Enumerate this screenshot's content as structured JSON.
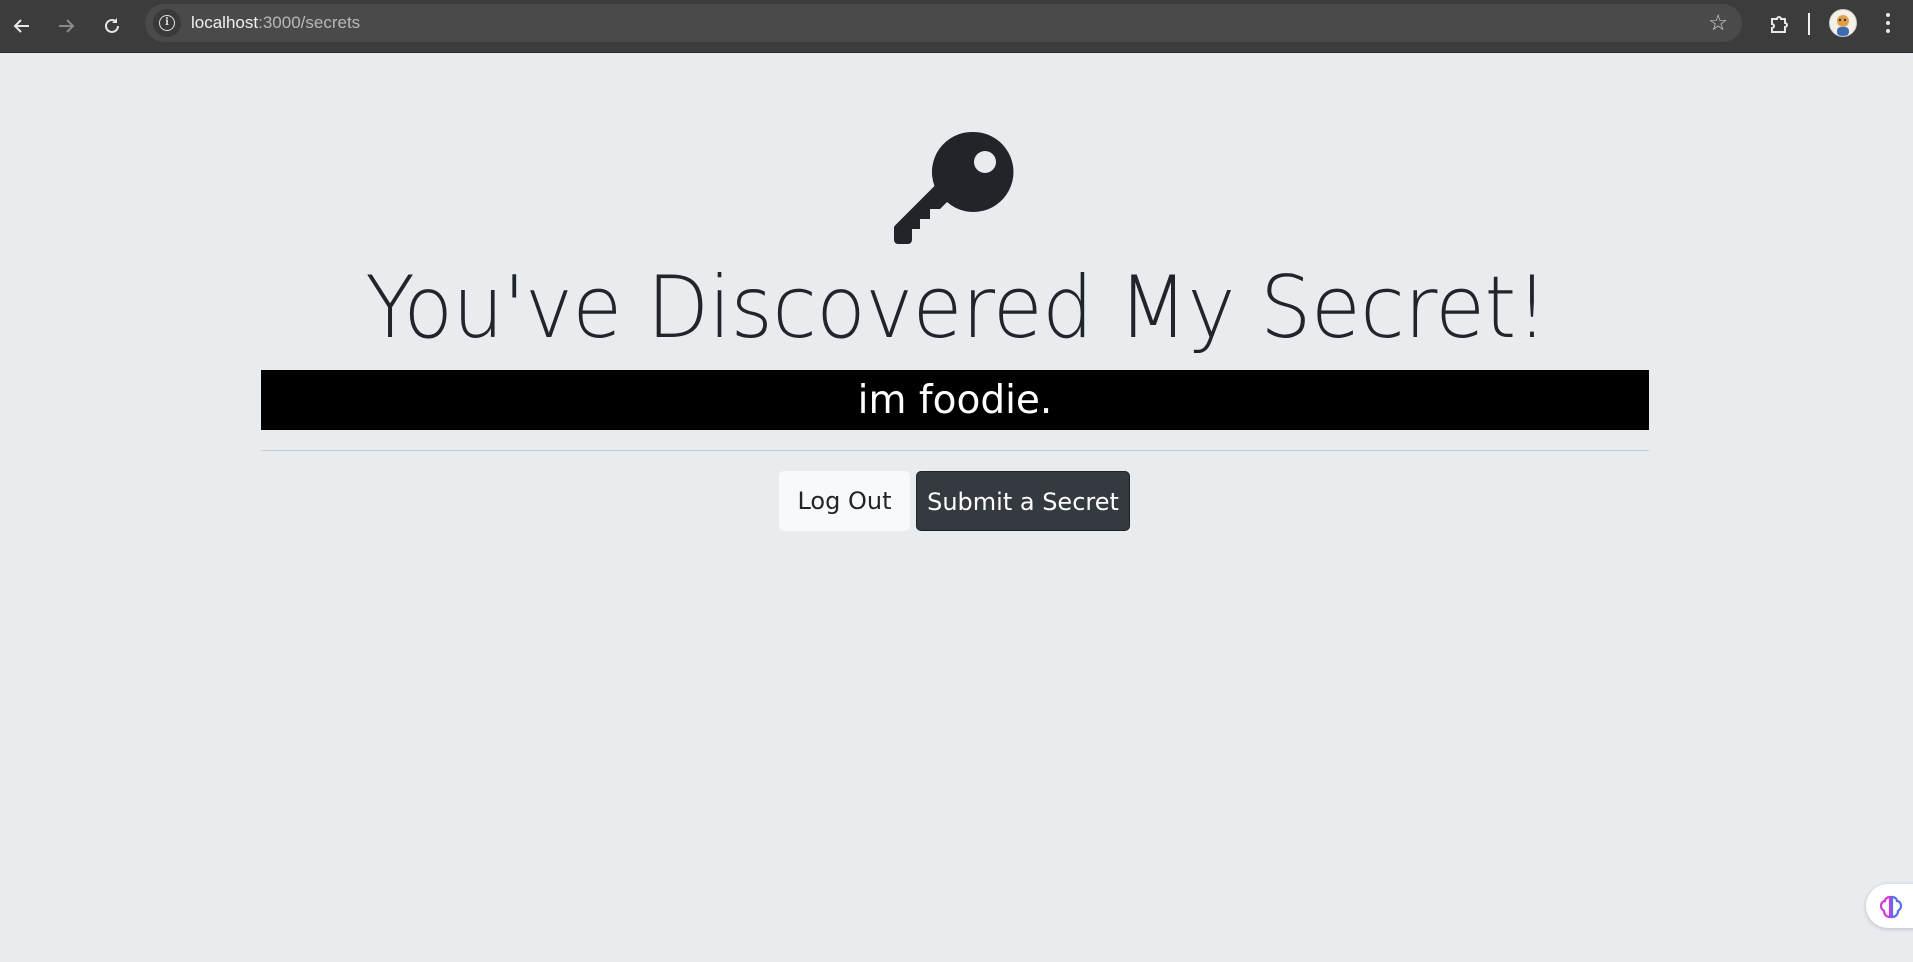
{
  "browser": {
    "url_host": "localhost",
    "url_path": ":3000/secrets",
    "icons": [
      "back-icon",
      "forward-icon",
      "reload-icon",
      "site-info-icon",
      "bookmark-star-icon",
      "extensions-icon",
      "profile-avatar",
      "more-menu-icon"
    ]
  },
  "page": {
    "title": "You've Discovered My Secret!",
    "secret_text": "im foodie.",
    "logout_label": "Log Out",
    "submit_label": "Submit a Secret"
  },
  "colors": {
    "background": "#e8ecef",
    "secret_bar": "#000000",
    "dark_button": "#343a40",
    "light_button": "#f8f9fa"
  }
}
